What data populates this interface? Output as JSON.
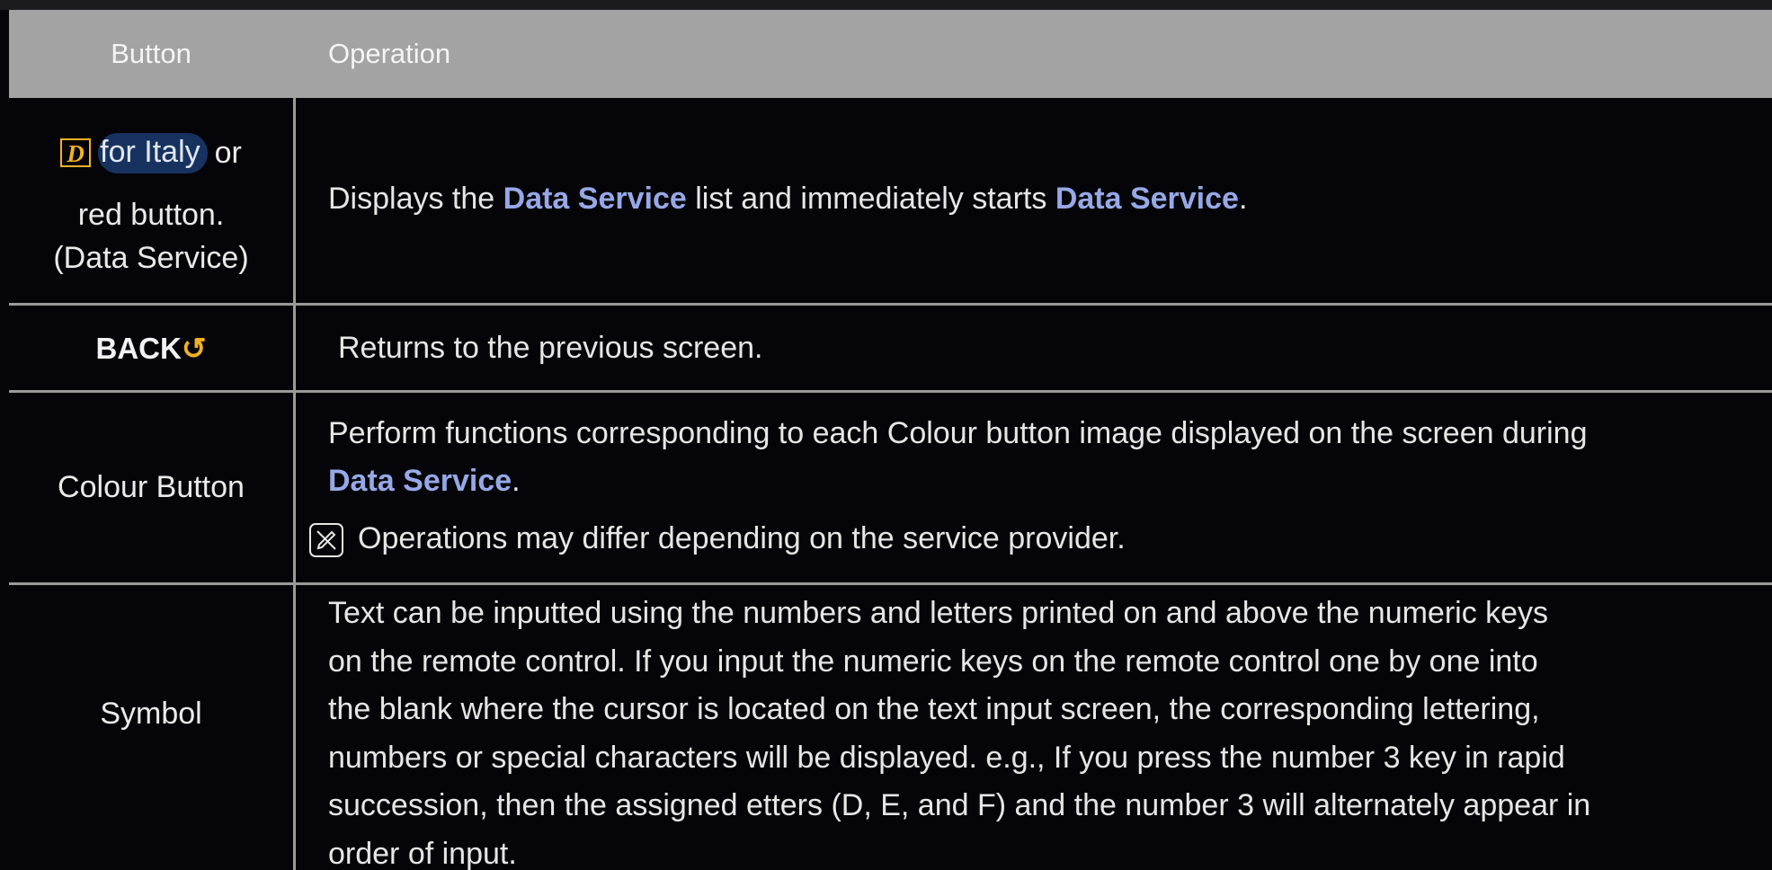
{
  "header": {
    "button_label": "Button",
    "operation_label": "Operation"
  },
  "rows": [
    {
      "button_line1_text": "for Italy",
      "button_line1_suffix": "or",
      "button_line2": "red button.",
      "button_line3": "(Data Service)",
      "icon_glyph": "D",
      "op_prefix": "Displays the ",
      "op_hl1": "Data Service",
      "op_mid": " list and immediately starts ",
      "op_hl2": "Data Service",
      "op_suffix": "."
    },
    {
      "button_label": "BACK",
      "button_icon_glyph": "↺",
      "operation": "Returns to the previous screen."
    },
    {
      "button_label": "Colour Button",
      "op_line1": "Perform functions corresponding to each Colour button image displayed on the screen during",
      "op_hl": "Data Service",
      "op_line2_suffix": ".",
      "note": "Operations may differ depending on the service provider."
    },
    {
      "button_label": "Symbol",
      "op_lines": [
        "Text can be inputted using the numbers and letters printed on and above the numeric keys",
        "on the remote control. If you input the numeric keys on the remote control one by one into",
        "the blank where the cursor is located on the text input screen, the corresponding lettering,",
        "numbers or special characters will be displayed. e.g., If you press the number 3 key in rapid",
        "succession, then the assigned etters (D, E, and F) and the number 3 will alternately appear in",
        "order of input."
      ]
    }
  ],
  "colors": {
    "background": "#050509",
    "header_bg": "#a3a3a3",
    "highlight": "#97a8e6",
    "icon_accent": "#f0b224",
    "pill_bg": "#17325e"
  },
  "icons": [
    "data-service-d-icon",
    "back-return-icon",
    "note-icon"
  ]
}
